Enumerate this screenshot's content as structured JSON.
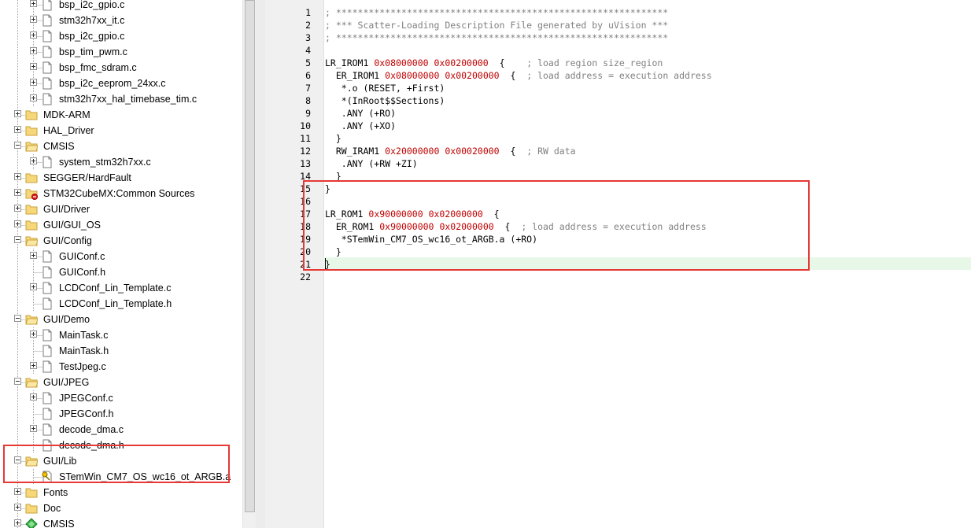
{
  "project_tree": {
    "rows": [
      {
        "label": "bsp_i2c_gpio.c",
        "depth": 1,
        "kind": "file",
        "expander": "plus"
      },
      {
        "label": "stm32h7xx_it.c",
        "depth": 1,
        "kind": "file",
        "expander": "plus"
      },
      {
        "label": "bsp_i2c_gpio.c",
        "depth": 1,
        "kind": "file",
        "expander": "plus"
      },
      {
        "label": "bsp_tim_pwm.c",
        "depth": 1,
        "kind": "file",
        "expander": "plus"
      },
      {
        "label": "bsp_fmc_sdram.c",
        "depth": 1,
        "kind": "file",
        "expander": "plus"
      },
      {
        "label": "bsp_i2c_eeprom_24xx.c",
        "depth": 1,
        "kind": "file",
        "expander": "plus"
      },
      {
        "label": "stm32h7xx_hal_timebase_tim.c",
        "depth": 1,
        "kind": "file",
        "expander": "plus"
      },
      {
        "label": "MDK-ARM",
        "depth": 0,
        "kind": "folder",
        "expander": "plus"
      },
      {
        "label": "HAL_Driver",
        "depth": 0,
        "kind": "folder",
        "expander": "plus"
      },
      {
        "label": "CMSIS",
        "depth": 0,
        "kind": "folder-open",
        "expander": "minus"
      },
      {
        "label": "system_stm32h7xx.c",
        "depth": 1,
        "kind": "file",
        "expander": "plus"
      },
      {
        "label": "SEGGER/HardFault",
        "depth": 0,
        "kind": "folder",
        "expander": "plus"
      },
      {
        "label": "STM32CubeMX:Common Sources",
        "depth": 0,
        "kind": "folder-cube",
        "expander": "plus"
      },
      {
        "label": "GUI/Driver",
        "depth": 0,
        "kind": "folder",
        "expander": "plus"
      },
      {
        "label": "GUI/GUI_OS",
        "depth": 0,
        "kind": "folder",
        "expander": "plus"
      },
      {
        "label": "GUI/Config",
        "depth": 0,
        "kind": "folder-open",
        "expander": "minus"
      },
      {
        "label": "GUIConf.c",
        "depth": 1,
        "kind": "file",
        "expander": "plus"
      },
      {
        "label": "GUIConf.h",
        "depth": 1,
        "kind": "file",
        "expander": "none"
      },
      {
        "label": "LCDConf_Lin_Template.c",
        "depth": 1,
        "kind": "file",
        "expander": "plus"
      },
      {
        "label": "LCDConf_Lin_Template.h",
        "depth": 1,
        "kind": "file",
        "expander": "none"
      },
      {
        "label": "GUI/Demo",
        "depth": 0,
        "kind": "folder-open",
        "expander": "minus"
      },
      {
        "label": "MainTask.c",
        "depth": 1,
        "kind": "file",
        "expander": "plus"
      },
      {
        "label": "MainTask.h",
        "depth": 1,
        "kind": "file",
        "expander": "none"
      },
      {
        "label": "TestJpeg.c",
        "depth": 1,
        "kind": "file",
        "expander": "plus"
      },
      {
        "label": "GUI/JPEG",
        "depth": 0,
        "kind": "folder-open",
        "expander": "minus"
      },
      {
        "label": "JPEGConf.c",
        "depth": 1,
        "kind": "file",
        "expander": "plus"
      },
      {
        "label": "JPEGConf.h",
        "depth": 1,
        "kind": "file",
        "expander": "none"
      },
      {
        "label": "decode_dma.c",
        "depth": 1,
        "kind": "file",
        "expander": "plus"
      },
      {
        "label": "decode_dma.h",
        "depth": 1,
        "kind": "file",
        "expander": "none"
      },
      {
        "label": "GUI/Lib",
        "depth": 0,
        "kind": "folder-open",
        "expander": "minus"
      },
      {
        "label": "STemWin_CM7_OS_wc16_ot_ARGB.a",
        "depth": 1,
        "kind": "lib",
        "expander": "none"
      },
      {
        "label": "Fonts",
        "depth": 0,
        "kind": "folder",
        "expander": "plus"
      },
      {
        "label": "Doc",
        "depth": 0,
        "kind": "folder",
        "expander": "plus"
      },
      {
        "label": "CMSIS",
        "depth": 0,
        "kind": "gem",
        "expander": "plus"
      }
    ]
  },
  "editor": {
    "lines": [
      {
        "num": "1",
        "segs": [
          {
            "t": "; *************************************************************",
            "c": "cm"
          }
        ]
      },
      {
        "num": "2",
        "segs": [
          {
            "t": "; *** Scatter-Loading Description File generated by uVision ***",
            "c": "cm"
          }
        ]
      },
      {
        "num": "3",
        "segs": [
          {
            "t": "; *************************************************************",
            "c": "cm"
          }
        ]
      },
      {
        "num": "4",
        "segs": []
      },
      {
        "num": "5",
        "segs": [
          {
            "t": "LR_IROM1 "
          },
          {
            "t": "0x08000000",
            "c": "hx"
          },
          {
            "t": " "
          },
          {
            "t": "0x00200000",
            "c": "hx"
          },
          {
            "t": "  {    "
          },
          {
            "t": "; load region size_region",
            "c": "cm"
          }
        ]
      },
      {
        "num": "6",
        "segs": [
          {
            "t": "  ER_IROM1 "
          },
          {
            "t": "0x08000000",
            "c": "hx"
          },
          {
            "t": " "
          },
          {
            "t": "0x00200000",
            "c": "hx"
          },
          {
            "t": "  {  "
          },
          {
            "t": "; load address = execution address",
            "c": "cm"
          }
        ]
      },
      {
        "num": "7",
        "segs": [
          {
            "t": "   *.o (RESET, +First)"
          }
        ]
      },
      {
        "num": "8",
        "segs": [
          {
            "t": "   *(InRoot$$Sections)"
          }
        ]
      },
      {
        "num": "9",
        "segs": [
          {
            "t": "   .ANY (+RO)"
          }
        ]
      },
      {
        "num": "10",
        "segs": [
          {
            "t": "   .ANY (+XO)"
          }
        ]
      },
      {
        "num": "11",
        "segs": [
          {
            "t": "  }"
          }
        ]
      },
      {
        "num": "12",
        "segs": [
          {
            "t": "  RW_IRAM1 "
          },
          {
            "t": "0x20000000",
            "c": "hx"
          },
          {
            "t": " "
          },
          {
            "t": "0x00020000",
            "c": "hx"
          },
          {
            "t": "  {  "
          },
          {
            "t": "; RW data",
            "c": "cm"
          }
        ]
      },
      {
        "num": "13",
        "segs": [
          {
            "t": "   .ANY (+RW +ZI)"
          }
        ]
      },
      {
        "num": "14",
        "segs": [
          {
            "t": "  }"
          }
        ]
      },
      {
        "num": "15",
        "segs": [
          {
            "t": "}"
          }
        ]
      },
      {
        "num": "16",
        "segs": []
      },
      {
        "num": "17",
        "segs": [
          {
            "t": "LR_ROM1 "
          },
          {
            "t": "0x90000000",
            "c": "hx"
          },
          {
            "t": " "
          },
          {
            "t": "0x02000000",
            "c": "hx"
          },
          {
            "t": "  {"
          }
        ]
      },
      {
        "num": "18",
        "segs": [
          {
            "t": "  ER_ROM1 "
          },
          {
            "t": "0x90000000",
            "c": "hx"
          },
          {
            "t": " "
          },
          {
            "t": "0x02000000",
            "c": "hx"
          },
          {
            "t": "  {  "
          },
          {
            "t": "; load address = execution address",
            "c": "cm"
          }
        ]
      },
      {
        "num": "19",
        "segs": [
          {
            "t": "   *STemWin_CM7_OS_wc16_ot_ARGB.a (+RO)"
          }
        ]
      },
      {
        "num": "20",
        "segs": [
          {
            "t": "  }"
          }
        ]
      },
      {
        "num": "21",
        "segs": [
          {
            "t": "}"
          }
        ]
      },
      {
        "num": "22",
        "segs": []
      }
    ]
  },
  "colors": {
    "highlight_box": "#e53935",
    "comment": "#808080",
    "hex_literal": "#c00000",
    "current_line": "#e8f8e8"
  }
}
